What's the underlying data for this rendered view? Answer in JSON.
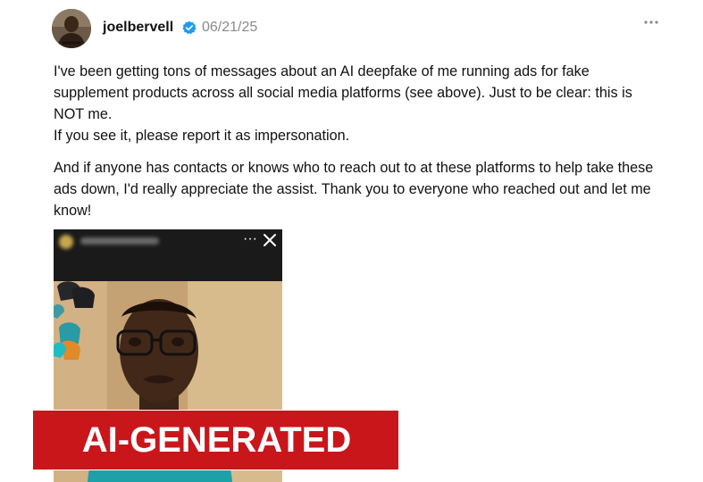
{
  "post": {
    "username": "joelbervell",
    "date": "06/21/25",
    "more_icon": "more-horizontal-icon",
    "paragraphs": [
      {
        "lines": [
          "I've been getting tons of messages about an AI deepfake of me running ads for fake supplement products across all social media platforms (see above). Just to be clear: this is NOT me.",
          "If you see it, please report it as impersonation."
        ]
      },
      {
        "lines": [
          "And if anyone has contacts or knows who to reach out to at these platforms to help take these ads down, I'd really appreciate the assist. Thank you to everyone who reached out and let me know!"
        ]
      }
    ],
    "media": {
      "dots": "···",
      "banner": "AI-GENERATED"
    }
  },
  "colors": {
    "verified_blue": "#1d9bf0",
    "banner_red": "#c9161b",
    "muted_gray": "#8a8a8a"
  }
}
